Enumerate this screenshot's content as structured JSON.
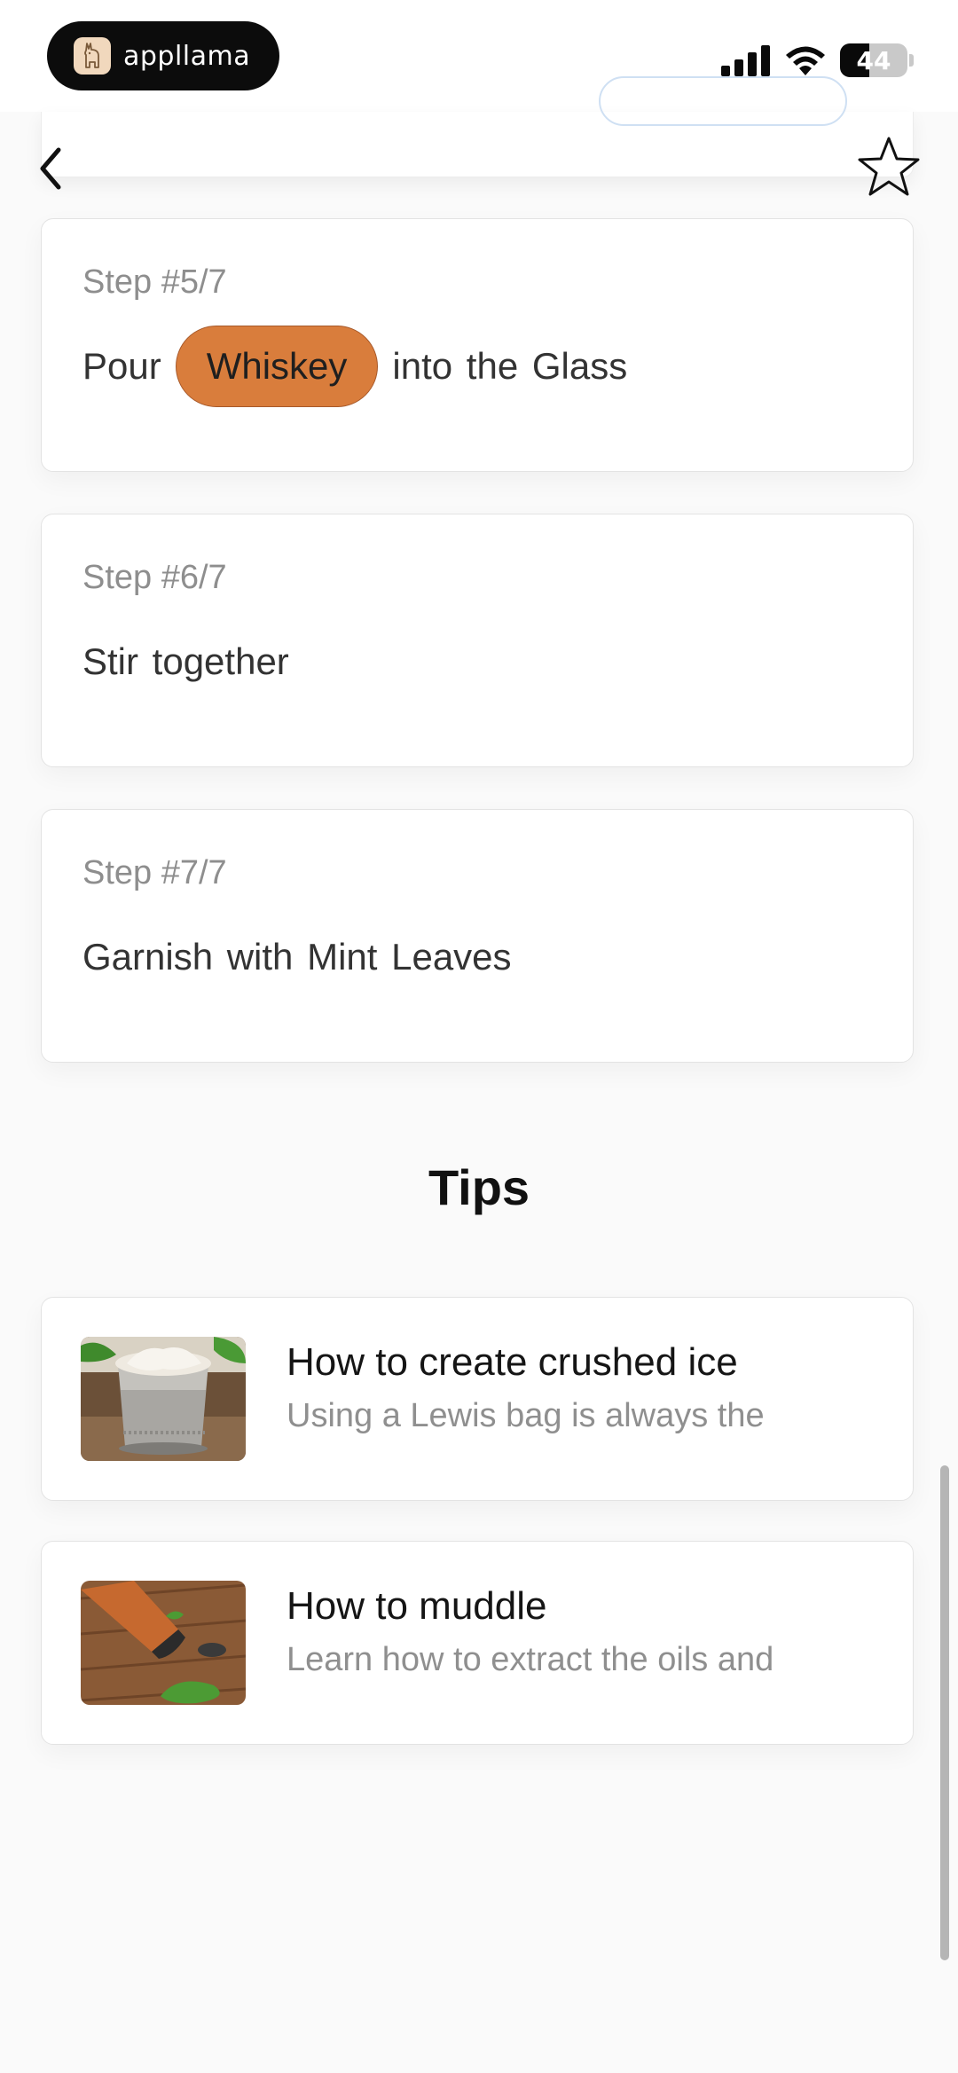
{
  "status_bar": {
    "app_name": "appllama",
    "battery": "44",
    "battery_level": 0.44
  },
  "steps": [
    {
      "label": "Step #5/7",
      "before": "Pour",
      "ingredient": "Whiskey",
      "after": "into the Glass"
    },
    {
      "label": "Step #6/7",
      "text": "Stir together"
    },
    {
      "label": "Step #7/7",
      "text": "Garnish with Mint Leaves"
    }
  ],
  "colors": {
    "ingredient_chip": "#d97d3c",
    "background": "#fafafa"
  },
  "tips": {
    "heading": "Tips",
    "items": [
      {
        "title": "How to create crushed ice",
        "subtitle": "Using a Lewis bag is always the",
        "image": "crushed-ice-in-silver-cup"
      },
      {
        "title": "How to muddle",
        "subtitle": "Learn how to extract the oils and",
        "image": "wooden-muddler-with-mint"
      }
    ]
  },
  "icons": {
    "back": "chevron-left-icon",
    "favorite": "star-outline-icon",
    "signal": "cellular-signal-icon",
    "wifi": "wifi-icon",
    "battery": "battery-icon"
  }
}
